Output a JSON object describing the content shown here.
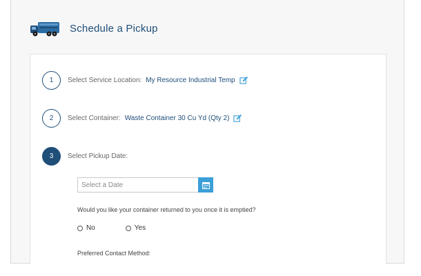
{
  "header": {
    "title": "Schedule a Pickup",
    "icon": "truck-icon"
  },
  "steps": [
    {
      "number": "1",
      "label": "Select Service Location:",
      "value": "My Resource Industrial Temp",
      "editable": true,
      "active": false
    },
    {
      "number": "2",
      "label": "Select Container:",
      "value": "Waste Container 30 Cu Yd (Qty 2)",
      "editable": true,
      "active": false
    },
    {
      "number": "3",
      "label": "Select Pickup Date:",
      "value": "",
      "editable": false,
      "active": true
    }
  ],
  "date_field": {
    "placeholder": "Select a Date",
    "value": "",
    "icon": "calendar-icon"
  },
  "return_question": {
    "text": "Would you like your container returned to you once it is emptied?",
    "options": [
      "No",
      "Yes"
    ],
    "selected": null
  },
  "contact": {
    "label": "Preferred Contact Method:"
  },
  "colors": {
    "accent": "#1f4e79",
    "button": "#3b9fd8",
    "page_bg": "#f7f7f7"
  }
}
